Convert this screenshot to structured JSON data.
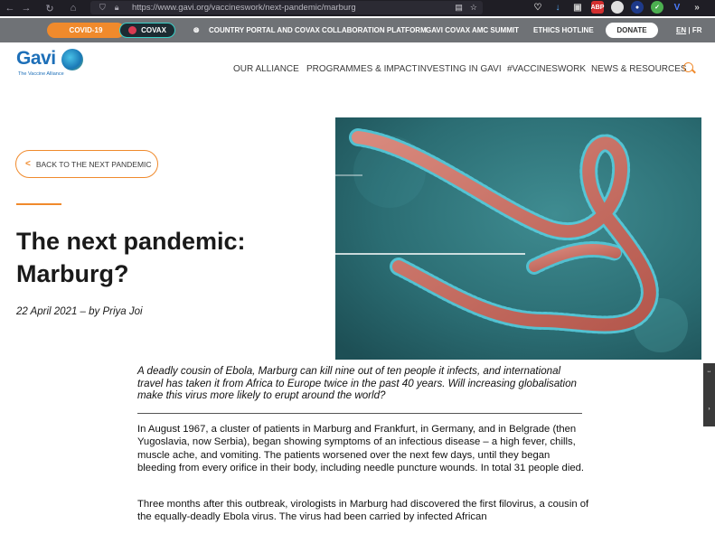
{
  "browser": {
    "back": "←",
    "forward": "→",
    "reload": "↻",
    "url": "https://www.gavi.org/vaccineswork/next-pandemic/marburg"
  },
  "utility_bar": {
    "covid_label": "COVID-19",
    "covax_label": "COVAX",
    "country_portal_label": "COUNTRY PORTAL AND COVAX COLLABORATION PLATFORM",
    "summit_label": "GAVI COVAX AMC SUMMIT",
    "ethics_label": "ETHICS HOTLINE",
    "donate_label": "DONATE",
    "lang_en": "EN",
    "lang_sep": "|",
    "lang_fr": "FR",
    "colors": {
      "bar": "#6f7276",
      "accent": "#f08a2c",
      "covax_dark": "#1c2b32"
    }
  },
  "logo": {
    "word": "Gavi",
    "tagline": "The Vaccine Alliance"
  },
  "main_nav": [
    {
      "label": "OUR ALLIANCE"
    },
    {
      "label": "PROGRAMMES & IMPACT"
    },
    {
      "label": "INVESTING IN GAVI"
    },
    {
      "label": "#VACCINESWORK"
    },
    {
      "label": "NEWS & RESOURCES"
    }
  ],
  "article": {
    "back_label": "BACK TO THE NEXT PANDEMIC",
    "title_line1": "The next pandemic:",
    "title_line2": "Marburg?",
    "byline": "22 April 2021 – by Priya Joi",
    "lede": "A deadly cousin of Ebola, Marburg can kill nine out of ten people it infects, and international travel has taken it from Africa to Europe twice in the past 40 years. Will increasing globalisation make this virus more likely to erupt around the world?",
    "paragraphs": [
      "In August 1967, a cluster of patients in Marburg and Frankfurt, in Germany, and in Belgrade (then Yugoslavia, now Serbia), began showing symptoms of an infectious disease – a high fever, chills, muscle ache, and vomiting. The patients worsened over the next few days, until they began bleeding from every orifice in their body, including needle puncture wounds. In total 31 people died.",
      "Three months after this outbreak, virologists in Marburg had discovered the first filovirus, a cousin of the equally-deadly Ebola virus. The virus had been carried by infected African"
    ]
  }
}
